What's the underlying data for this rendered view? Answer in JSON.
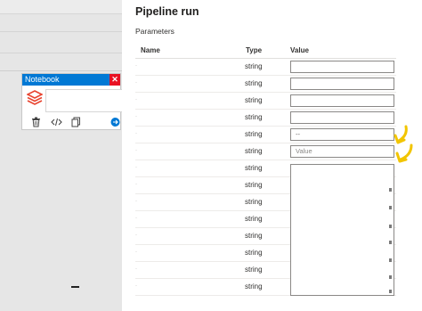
{
  "panel": {
    "title": "Pipeline run",
    "section_label": "Parameters",
    "columns": {
      "name": "Name",
      "type": "Type",
      "value": "Value"
    }
  },
  "rows": [
    {
      "type": "string",
      "value": ""
    },
    {
      "type": "string",
      "value": ""
    },
    {
      "type": "string",
      "value": ""
    },
    {
      "type": "string",
      "value": ""
    },
    {
      "type": "string",
      "value": "--"
    },
    {
      "type": "string",
      "value": "",
      "placeholder": "Value"
    },
    {
      "type": "string"
    },
    {
      "type": "string"
    },
    {
      "type": "string"
    },
    {
      "type": "string"
    },
    {
      "type": "string"
    },
    {
      "type": "string"
    },
    {
      "type": "string"
    },
    {
      "type": "string"
    }
  ],
  "notebook": {
    "title": "Notebook",
    "icons": [
      "databricks-logo-icon",
      "delete-icon",
      "code-icon",
      "copy-icon",
      "arrow-right-icon"
    ]
  },
  "colors": {
    "accent": "#0078d4",
    "close": "#e81123",
    "highlight_arrow": "#f2c500"
  }
}
